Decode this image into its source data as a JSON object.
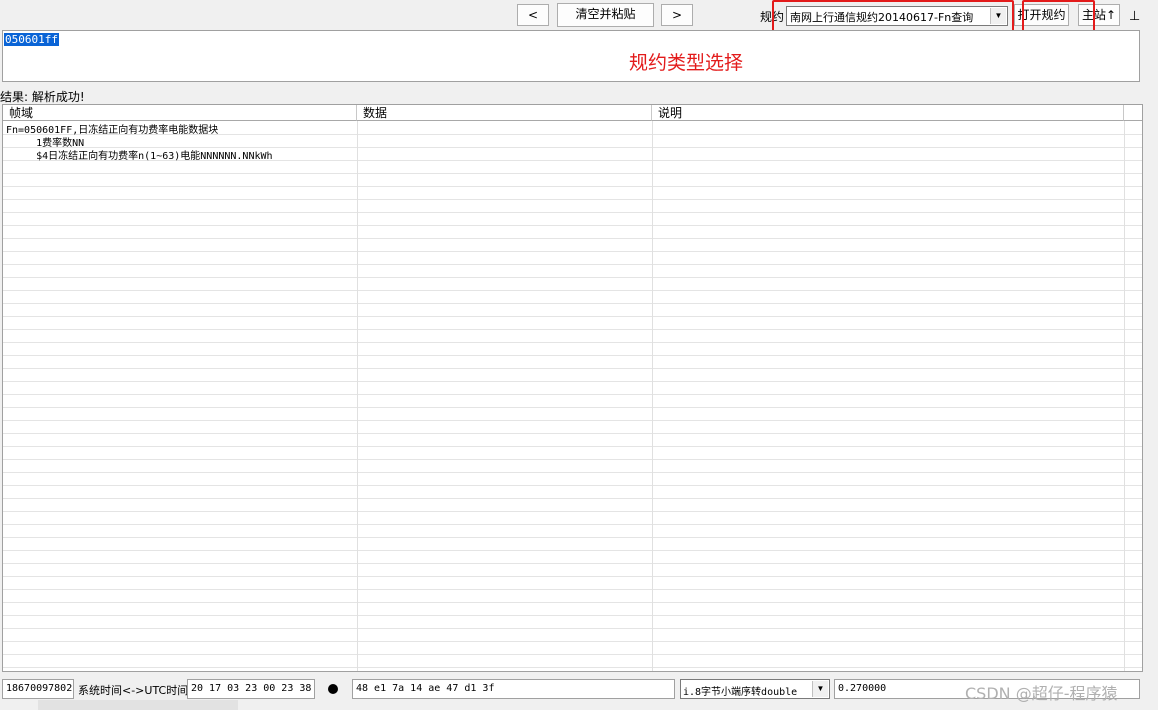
{
  "toolbar": {
    "prev_label": "<",
    "clear_paste_label": "清空并粘贴",
    "next_label": ">",
    "protocol_label": "规约",
    "protocol_value": "南网上行通信规约20140617-Fn查询",
    "open_protocol_label": "打开规约",
    "main_station_label": "主站↑",
    "pin_label": "⊥"
  },
  "annotation": {
    "text": "规约类型选择",
    "color": "#e31b1b"
  },
  "input": {
    "text": "050601ff"
  },
  "result": {
    "text": "结果: 解析成功!"
  },
  "table": {
    "headers": [
      "帧域",
      "数据",
      "说明"
    ],
    "rows": [
      "Fn=050601FF,日冻结正向有功费率电能数据块",
      "     1费率数NN",
      "     $4日冻结正向有功费率n(1~63)电能NNNNNN.NNkWh"
    ]
  },
  "statusbar": {
    "address": "18670097802",
    "time_label": "系统时间<->UTC时间",
    "time_value": "20 17 03 23 00 23 38",
    "hex_bytes": "48 e1 7a 14 ae 47 d1 3f",
    "conversion_mode": "i.8字节小端序转double",
    "conversion_result": "0.270000"
  },
  "watermark": "CSDN @超仔-程序猿",
  "colors": {
    "selection": "#0a64d6",
    "highlight": "#e31b1b"
  }
}
